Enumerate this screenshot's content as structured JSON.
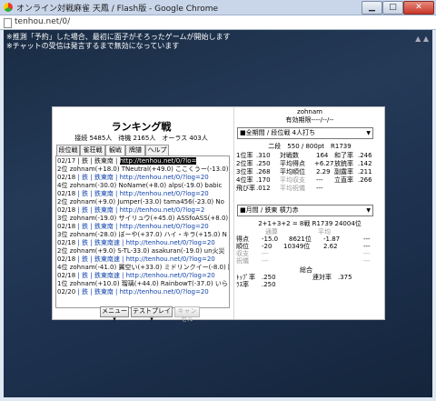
{
  "window": {
    "title": "オンライン対戦麻雀 天鳳 / Flash版 - Google Chrome",
    "url": "tenhou.net/0/"
  },
  "notice": {
    "line1": "※推測「予約」した場合、最初に面子がそろったゲームが開始します",
    "line2": "※チャットの受信は発言するまで無効になっています"
  },
  "ranking": {
    "title": "ランキング戦",
    "stats": "接続 5485人　待機 2165人　オーラス 403人",
    "tabs": [
      "段位戦",
      "雀荘戦",
      "観戦",
      "牌譜",
      "ヘルプ"
    ],
    "rows": [
      {
        "prefix": "02/17",
        "text": "| 鉄 | 鉄東南 | http://tenhou.net/0/?lo="
      },
      {
        "prefix": "2位",
        "text": "zohnam(+18.0) TNeutral(+49.0) ここくうー(-13.0) se"
      },
      {
        "prefix": "02/18",
        "text": "| 鉄 | 鉄東南 | http://tenhou.net/0/?log=20"
      },
      {
        "prefix": "4位",
        "text": "zohnam(-30.0) NoName(+8.0) alps(-19.0) babic"
      },
      {
        "prefix": "02/18",
        "text": "| 鉄 | 鉄東南 | http://tenhou.net/0/?log=20"
      },
      {
        "prefix": "2位",
        "text": "zohnam(+9.0) Jumper(-33.0) tama456(-23.0) No"
      },
      {
        "prefix": "02/18",
        "text": "| 鉄 | 鉄東南 | http://tenhou.net/0/?log=2"
      },
      {
        "prefix": "3位",
        "text": "zohnam(-19.0) サイリュウ(+45.0) ASSfoASS(+8.0)"
      },
      {
        "prefix": "02/18",
        "text": "| 鉄 | 鉄東南 | http://tenhou.net/0/?log=20"
      },
      {
        "prefix": "3位",
        "text": "zohnam(-28.0) ぼーや(+37.0) ハイ・キラ(+15.0) N"
      },
      {
        "prefix": "02/18",
        "text": "| 鉄 | 鉄東南速 | http://tenhou.net/0/?log=20"
      },
      {
        "prefix": "2位",
        "text": "zohnam(+9.0) S-TL-33.0) asakuran(-19.0) un火災"
      },
      {
        "prefix": "02/18",
        "text": "| 鉄 | 鉄東南速 | http://tenhou.net/0/?log=20"
      },
      {
        "prefix": "4位",
        "text": "zohnam(-41.0) 翼空い(+33.0) ミドリンクイー(-8.0) 牌"
      },
      {
        "prefix": "02/18",
        "text": "| 鉄 | 鉄東南速 | http://tenhou.net/0/?log=20"
      },
      {
        "prefix": "1位",
        "text": "zohnam(+10.0) 瑠璃(+44.0) RainbowT(-37.0) いら"
      },
      {
        "prefix": "02/20",
        "text": "| 鉄 | 鉄東南 | http://tenhou.net/0/?log=20"
      }
    ],
    "highlight": "http://tenhou.net/0/?lo=",
    "buttons": {
      "menu": "メニュー ▾",
      "test": "テストプレイ ▾",
      "cancel": "キャンセル"
    }
  },
  "profile": {
    "name": "zohnam",
    "expire": "有効期限----/--/--",
    "select1": "■全期間 / 段位戦 4人打ち",
    "dan": "二段　550 / 800pt　R1739",
    "rows1": [
      [
        "1位率",
        ".310",
        "対戦数",
        "164",
        "和了率",
        ".246"
      ],
      [
        "2位率",
        ".250",
        "平均得点",
        "+6.27",
        "放銃率",
        ".142"
      ],
      [
        "3位率",
        ".268",
        "平均順位",
        "2.29",
        "副露率",
        ".211"
      ],
      [
        "4位率",
        ".170",
        "平均収支",
        "---",
        "立直率",
        ".266"
      ],
      [
        "飛び率",
        ".012",
        "平均祝儀",
        "---",
        "",
        ""
      ]
    ],
    "select2": "■月間 / 鉄東 槓力赤",
    "head2": "2+1+3+2 = 8戦   R1739  24004位",
    "rows2": [
      [
        "",
        "通算",
        "平均",
        "",
        "",
        ""
      ],
      [
        "得点",
        "-15.0",
        "8621位",
        "-1.87",
        "---",
        ""
      ],
      [
        "順位",
        "-20",
        "10349位",
        "2.62",
        "---",
        ""
      ],
      [
        "収支",
        "---",
        "",
        "",
        "---",
        ""
      ],
      [
        "祝儀",
        "---",
        "",
        "",
        "---",
        ""
      ],
      [
        "",
        "",
        "総合",
        "",
        "",
        ""
      ],
      [
        "ﾄｯﾌﾟ率",
        ".250",
        "",
        "連対率",
        ".375",
        ""
      ],
      [
        "ﾗｽ率",
        ".250",
        "",
        "",
        "",
        ""
      ]
    ]
  }
}
